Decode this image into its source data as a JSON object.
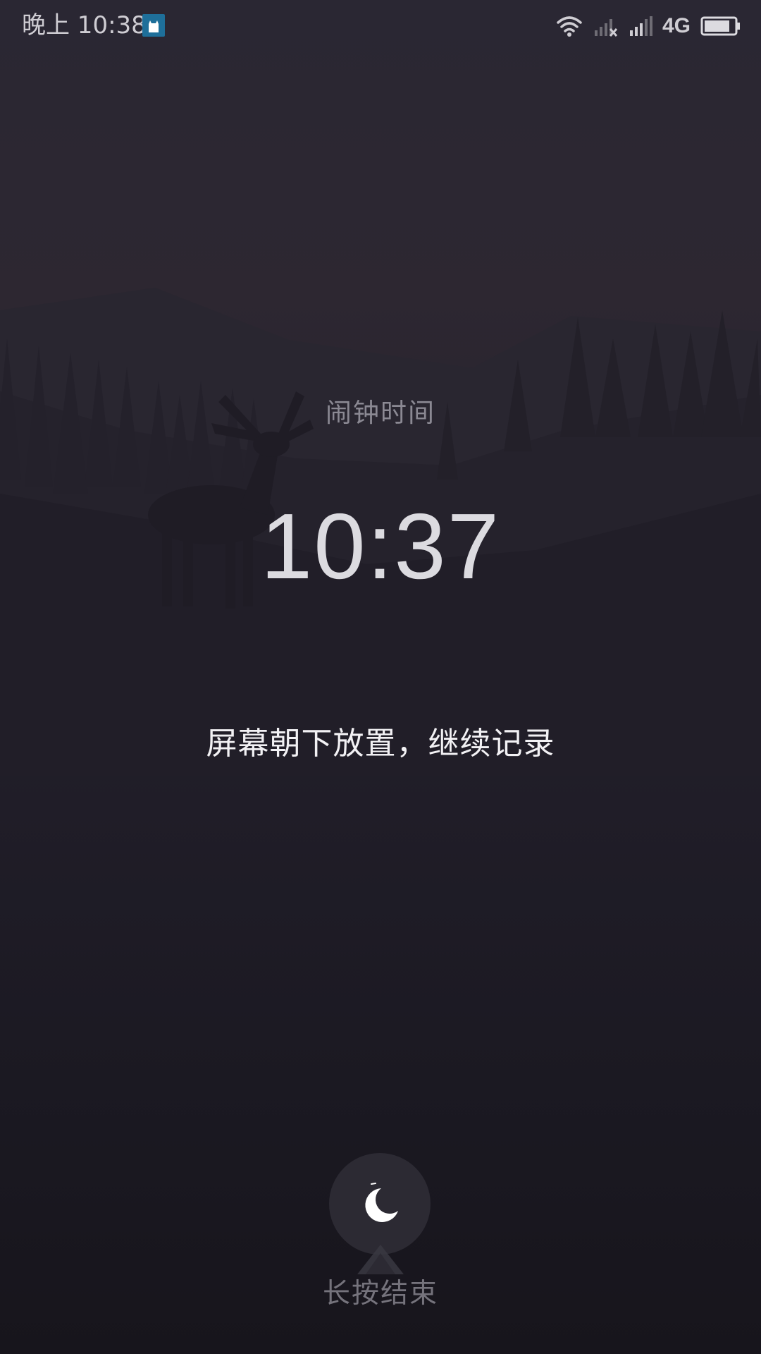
{
  "status_bar": {
    "time": "晚上 10:38",
    "network": "4G",
    "battery_level": 0.85,
    "icons": [
      "app-notification-icon",
      "wifi-icon",
      "signal-no-sim-icon",
      "signal-icon",
      "battery-icon"
    ]
  },
  "alarm": {
    "label": "闹钟时间",
    "time": "10:37"
  },
  "hint": {
    "text": "屏幕朝下放置，继续记录"
  },
  "bottom": {
    "button_icon": "moon-icon",
    "end_label": "长按结束"
  },
  "colors": {
    "background_top": "#2a2733",
    "background_bottom": "#17151c",
    "time_text": "#dcdbe0",
    "label_text": "#8b8993"
  }
}
